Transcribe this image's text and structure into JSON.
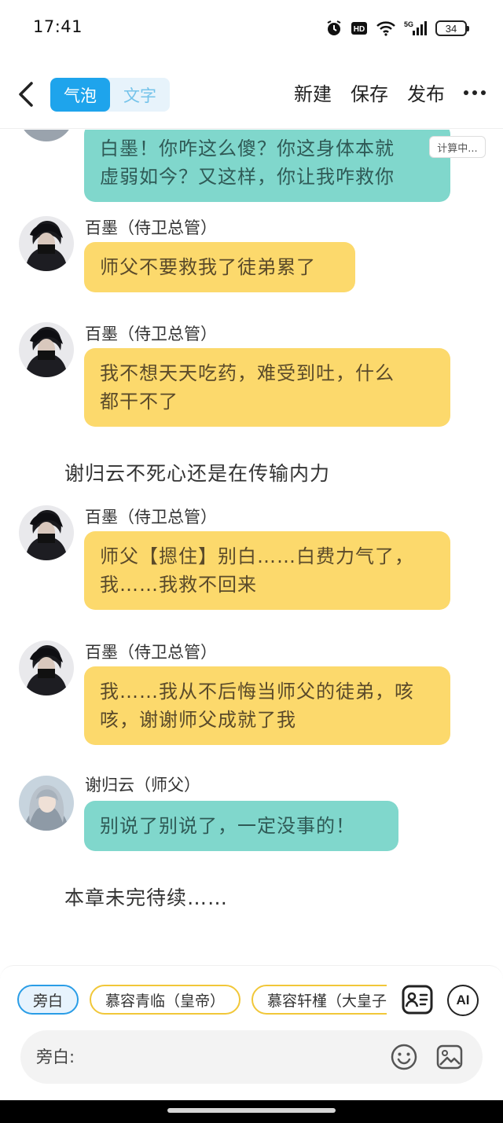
{
  "status": {
    "time": "17:41",
    "battery": "34"
  },
  "topbar": {
    "mode_tabs": [
      "气泡",
      "文字"
    ],
    "actions": {
      "new": "新建",
      "save": "保存",
      "publish": "发布"
    }
  },
  "chat": {
    "calc_tag": "计算中...",
    "messages": [
      {
        "type": "bubble",
        "color": "teal",
        "lines": [
          "白墨！你咋这么傻？你这身体本就",
          "虚弱如今？又这样，你让我咋救你"
        ]
      },
      {
        "type": "bubble",
        "speaker": "百墨（侍卫总管）",
        "color": "yellow",
        "lines": [
          "师父不要救我了徒弟累了"
        ]
      },
      {
        "type": "bubble",
        "speaker": "百墨（侍卫总管）",
        "color": "yellow",
        "lines": [
          "我不想天天吃药，难受到吐，什么",
          "都干不了"
        ]
      },
      {
        "type": "narration",
        "text": "谢归云不死心还是在传输内力"
      },
      {
        "type": "bubble",
        "speaker": "百墨（侍卫总管）",
        "color": "yellow",
        "lines": [
          "师父【摁住】别白……白费力气了，",
          "我……我救不回来"
        ]
      },
      {
        "type": "bubble",
        "speaker": "百墨（侍卫总管）",
        "color": "yellow",
        "lines": [
          "我……我从不后悔当师父的徒弟，咳",
          "咳，谢谢师父成就了我"
        ]
      },
      {
        "type": "bubble",
        "speaker": "谢归云（师父）",
        "color": "teal",
        "lines": [
          "别说了别说了，一定没事的！"
        ]
      },
      {
        "type": "narration",
        "text": "本章未完待续……"
      }
    ]
  },
  "composer": {
    "roles": [
      "旁白",
      "慕容青临（皇帝）",
      "慕容轩槿（大皇子）"
    ],
    "ai_label": "AI",
    "input_placeholder": "旁白:"
  },
  "colors": {
    "accent": "#1ea4ec",
    "bubble_yellow": "#fcd96c",
    "bubble_teal": "#80d7cc",
    "chip_border": "#f1c739"
  }
}
